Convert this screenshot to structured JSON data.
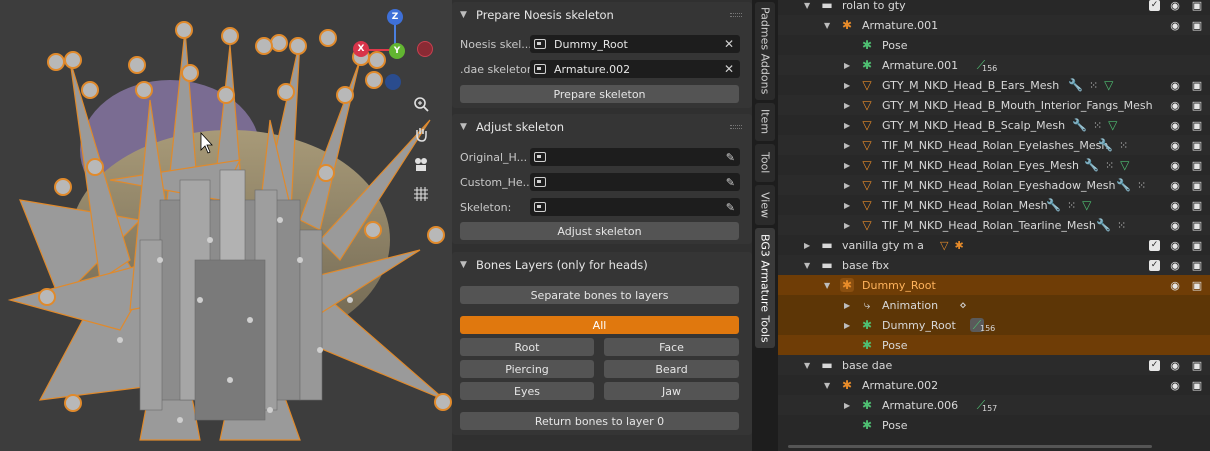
{
  "colors": {
    "accent": "#e0780e",
    "selected_row": "#6f3d06",
    "panel_bg": "#303030",
    "viewport_bg": "#3d3d3d",
    "outliner_bg": "#282828"
  },
  "viewport": {
    "gizmo": {
      "z": "Z",
      "x": "X",
      "y": "Y"
    },
    "nav_icons": [
      "zoom-icon",
      "hand-pan-icon",
      "camera-icon",
      "grid-ortho-icon"
    ]
  },
  "npanel": {
    "prepare": {
      "title": "Prepare Noesis skeleton",
      "noesis_label": "Noesis skel...",
      "noesis_value": "Dummy_Root",
      "dae_label": ".dae skeleton:",
      "dae_value": "Armature.002",
      "button": "Prepare skeleton"
    },
    "adjust": {
      "title": "Adjust skeleton",
      "original_label": "Original_H...",
      "custom_label": "Custom_He...",
      "skeleton_label": "Skeleton:",
      "button": "Adjust skeleton"
    },
    "bones": {
      "title": "Bones Layers (only for heads)",
      "separate_button": "Separate bones to layers",
      "all_button": "All",
      "root": "Root",
      "face": "Face",
      "piercing": "Piercing",
      "beard": "Beard",
      "eyes": "Eyes",
      "jaw": "Jaw",
      "return_button": "Return bones to layer 0"
    }
  },
  "tabs": [
    "Padmes Addons",
    "Item",
    "Tool",
    "View",
    "BG3 Armature Tools"
  ],
  "outliner": {
    "rows": [
      {
        "name": "rolan to gty"
      },
      {
        "name": "Armature.001"
      },
      {
        "name": "Pose"
      },
      {
        "name": "Armature.001",
        "badge": "156"
      },
      {
        "name": "GTY_M_NKD_Head_B_Ears_Mesh"
      },
      {
        "name": "GTY_M_NKD_Head_B_Mouth_Interior_Fangs_Mesh"
      },
      {
        "name": "GTY_M_NKD_Head_B_Scalp_Mesh"
      },
      {
        "name": "TIF_M_NKD_Head_Rolan_Eyelashes_Mesh"
      },
      {
        "name": "TIF_M_NKD_Head_Rolan_Eyes_Mesh"
      },
      {
        "name": "TIF_M_NKD_Head_Rolan_Eyeshadow_Mesh"
      },
      {
        "name": "TIF_M_NKD_Head_Rolan_Mesh"
      },
      {
        "name": "TIF_M_NKD_Head_Rolan_Tearline_Mesh"
      },
      {
        "name": "vanilla gty m a"
      },
      {
        "name": "base fbx"
      },
      {
        "name": "Dummy_Root"
      },
      {
        "name": "Animation"
      },
      {
        "name": "Dummy_Root",
        "badge": "156"
      },
      {
        "name": "Pose"
      },
      {
        "name": "base dae"
      },
      {
        "name": "Armature.002"
      },
      {
        "name": "Armature.006",
        "badge": "157"
      },
      {
        "name": "Pose"
      }
    ]
  }
}
